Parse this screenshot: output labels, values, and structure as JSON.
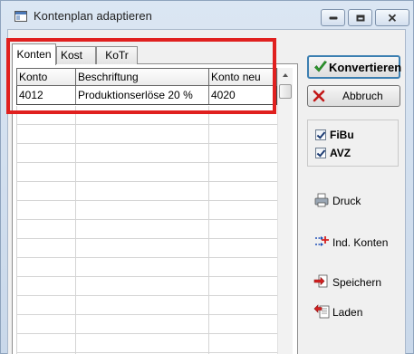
{
  "window": {
    "title": "Kontenplan adaptieren"
  },
  "tabs": [
    {
      "label": "Konten",
      "active": true
    },
    {
      "label": "Kost",
      "active": false
    },
    {
      "label": "KoTr",
      "active": false
    }
  ],
  "table": {
    "columns": [
      "Konto",
      "Beschriftung",
      "Konto neu"
    ],
    "rows": [
      [
        "4012",
        "Produktionserlöse 20 %",
        "4020"
      ]
    ]
  },
  "buttons": {
    "convert": "Konvertieren",
    "cancel": "Abbruch"
  },
  "options": [
    {
      "label": "FiBu",
      "checked": true
    },
    {
      "label": "AVZ",
      "checked": true
    }
  ],
  "tools": {
    "print": "Druck",
    "ind_accounts": "Ind. Konten",
    "save": "Speichern",
    "load": "Laden"
  },
  "colors": {
    "highlight": "#e0201f",
    "convert_border": "#3c7fb1"
  }
}
